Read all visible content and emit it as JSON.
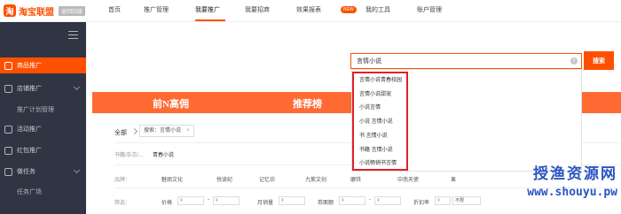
{
  "header": {
    "logo_text": "淘宝联盟",
    "logo_badge": "返回旧版",
    "nav": [
      {
        "label": "首页"
      },
      {
        "label": "推广管理"
      },
      {
        "label": "我要推广"
      },
      {
        "label": "我要招商"
      },
      {
        "label": "效果报表",
        "badge": "NEW"
      },
      {
        "label": "我的工具"
      },
      {
        "label": "账户管理"
      }
    ],
    "active_nav": "我要推广"
  },
  "sidebar": {
    "items": [
      {
        "label": "商品推广",
        "active": true
      },
      {
        "label": "店铺推广"
      },
      {
        "label": "推广计划管理",
        "sub": true
      },
      {
        "label": "活动推广"
      },
      {
        "label": "红包推广"
      },
      {
        "label": "做任务"
      },
      {
        "label": "任务广场",
        "sub": true
      }
    ]
  },
  "search": {
    "value": "言情小说",
    "clear_icon": "×",
    "button_label": "搜索"
  },
  "banner": {
    "tabs": [
      "前N高佣",
      "推荐榜"
    ]
  },
  "filters": {
    "crumb_all": "全部",
    "crumb_tag": "搜索：言情小说",
    "crumb_tag_close": "×",
    "rows": [
      {
        "label": "书籍/杂志/...",
        "options": [
          "青春小说"
        ]
      },
      {
        "label": "品牌：",
        "options": [
          "魅丽文化",
          "悦读纪",
          "记忆坊",
          "九紫文创",
          "磨铁",
          "中南天使",
          "果"
        ]
      },
      {
        "label": "筛选："
      }
    ],
    "price": {
      "price_label": "价格",
      "yuan": "¥",
      "dash": "-",
      "sales_label": "月销量",
      "commission_label": "券面额",
      "discount_label": "折扣率",
      "discount_option": "不限"
    }
  },
  "suggestions": [
    "言情小说青春校园",
    "言情小说甜宠",
    "小说言情",
    "小说 言情小说",
    "书 言情小说",
    "书籍 言情小说",
    "小说畅销书言情"
  ],
  "watermark": {
    "cn": "授渔资源网",
    "url": "www.shouyu.pw"
  },
  "colors": {
    "accent": "#ff5000",
    "banner": "#ff6a33",
    "sidebar": "#2f3543",
    "highlight": "#e01f2d",
    "watermark": "#2b54c2"
  }
}
